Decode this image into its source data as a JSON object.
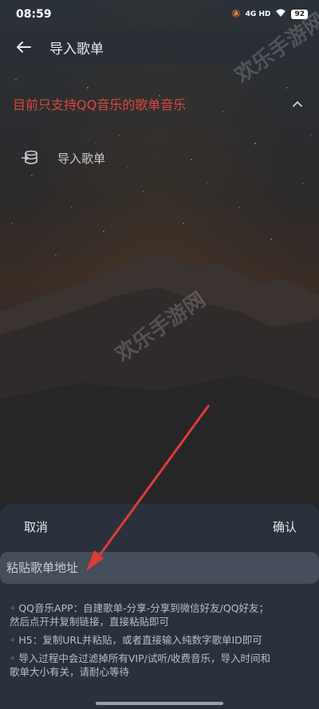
{
  "status_bar": {
    "time": "08:59",
    "network": "4G HD",
    "battery": "92"
  },
  "header": {
    "title": "导入歌单"
  },
  "notice": {
    "text": "目前只支持QQ音乐的歌单音乐"
  },
  "import_option": {
    "label": "导入歌单"
  },
  "sheet": {
    "cancel_label": "取消",
    "confirm_label": "确认",
    "input_placeholder": "粘贴歌单地址",
    "tips": [
      "◦ QQ音乐APP：自建歌单-分享-分享到微信好友/QQ好友；\n然后点开并复制链接，直接粘贴即可",
      "◦ H5：复制URL并粘贴，或者直接输入纯数字歌单ID即可",
      "◦ 导入过程中会过滤掉所有VIP/试听/收费音乐，导入时间和\n歌单大小有关，请耐心等待"
    ]
  },
  "watermark": "欢乐手游网",
  "colors": {
    "notice_red": "#d9473e",
    "annotation_arrow": "#e03a3a",
    "sheet_bg": "#2b313b",
    "input_bg": "#464e5b"
  }
}
